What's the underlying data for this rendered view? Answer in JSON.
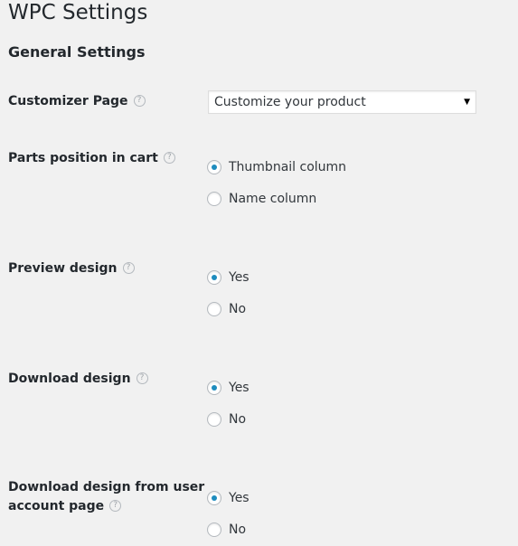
{
  "page": {
    "title": "WPC Settings"
  },
  "section": {
    "title": "General Settings"
  },
  "help_glyph": "?",
  "fields": [
    {
      "label": "Customizer Page",
      "type": "select",
      "selected": "Customize your product"
    },
    {
      "label": "Parts position in cart",
      "type": "radio",
      "options": [
        {
          "label": "Thumbnail column",
          "checked": true
        },
        {
          "label": "Name column",
          "checked": false
        }
      ]
    },
    {
      "label": "Preview design",
      "type": "radio",
      "options": [
        {
          "label": "Yes",
          "checked": true
        },
        {
          "label": "No",
          "checked": false
        }
      ]
    },
    {
      "label": "Download design",
      "type": "radio",
      "options": [
        {
          "label": "Yes",
          "checked": true
        },
        {
          "label": "No",
          "checked": false
        }
      ]
    },
    {
      "label_line1": "Download design from user",
      "label_line2": "account page",
      "type": "radio",
      "options": [
        {
          "label": "Yes",
          "checked": true
        },
        {
          "label": "No",
          "checked": false
        }
      ]
    }
  ],
  "colors": {
    "background": "#f1f1f1",
    "text": "#23282d",
    "radio_checked": "#1e8cbe",
    "help_icon": "#a0a5aa"
  }
}
